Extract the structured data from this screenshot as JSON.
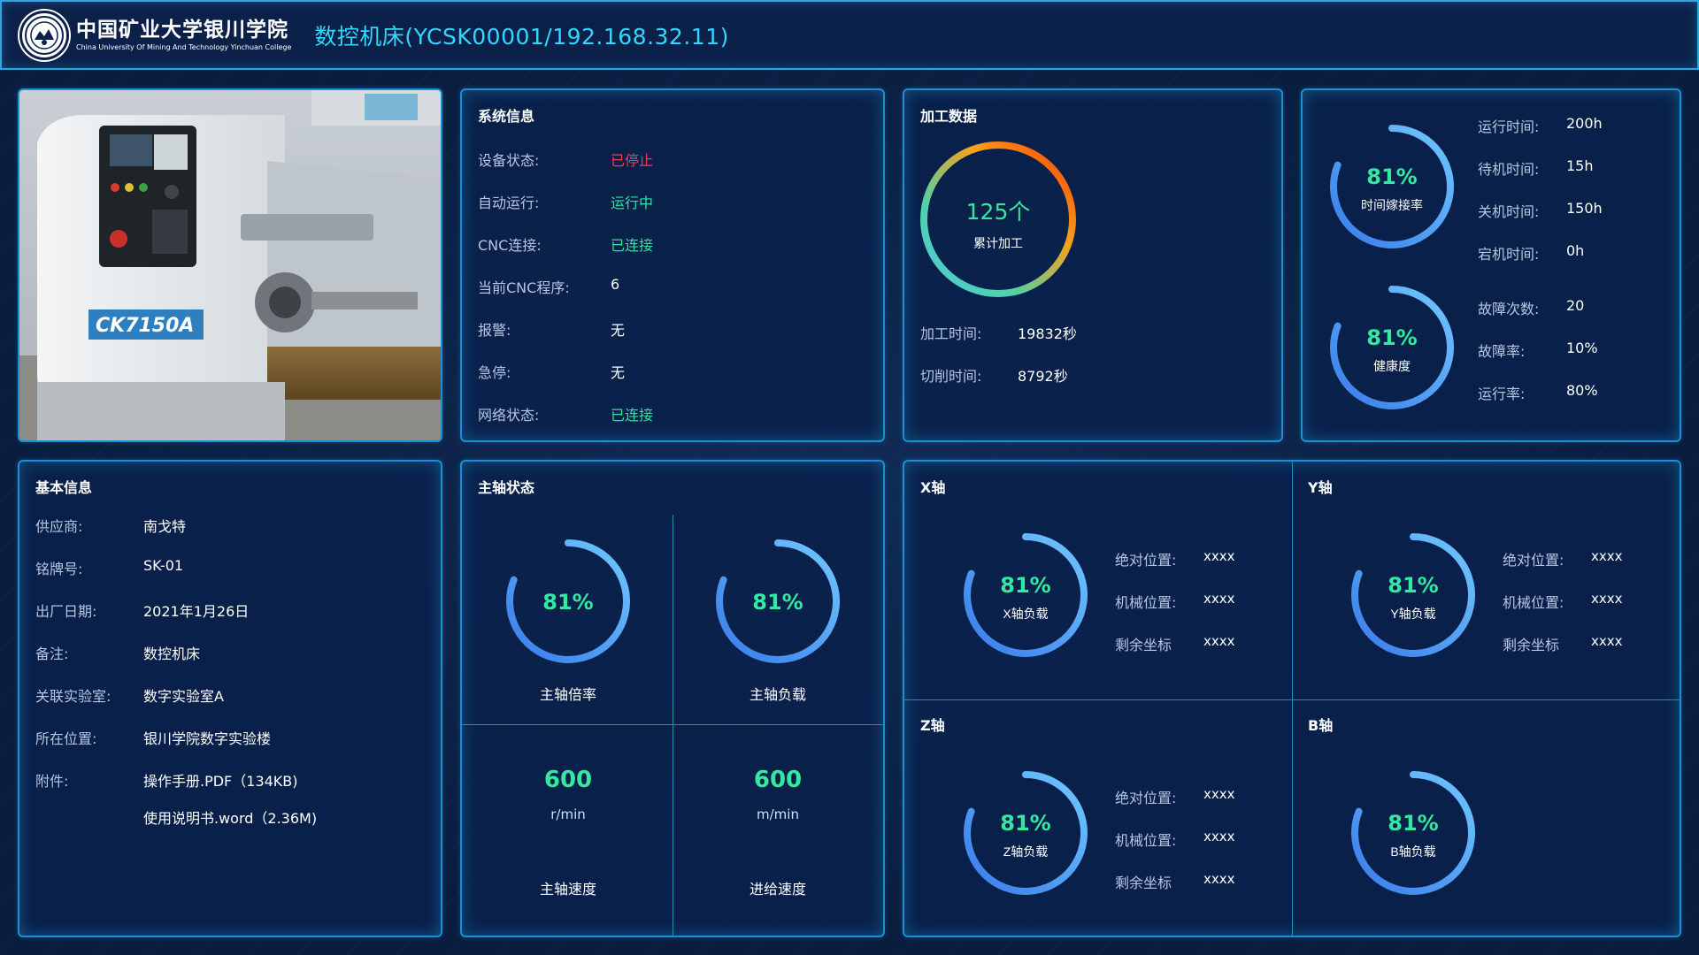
{
  "header": {
    "logo_cn": "中国矿业大学银川学院",
    "logo_en": "China University Of Mining And Technology Yinchuan College",
    "title": "数控机床(YCSK00001/192.168.32.11)"
  },
  "photo": {
    "plate": "CK7150A"
  },
  "system_info": {
    "title": "系统信息",
    "rows": [
      {
        "label": "设备状态:",
        "value": "已停止",
        "color": "#ff3b4a"
      },
      {
        "label": "自动运行:",
        "value": "运行中",
        "color": "#2fe39a"
      },
      {
        "label": "CNC连接:",
        "value": "已连接",
        "color": "#2fe39a"
      },
      {
        "label": "当前CNC程序:",
        "value": "6",
        "color": "#ffffff"
      },
      {
        "label": "报警:",
        "value": "无",
        "color": "#ffffff"
      },
      {
        "label": "急停:",
        "value": "无",
        "color": "#ffffff"
      },
      {
        "label": "网络状态:",
        "value": "已连接",
        "color": "#2fe39a"
      }
    ]
  },
  "processing": {
    "title": "加工数据",
    "total_value": "125个",
    "total_caption": "累计加工",
    "rows": [
      {
        "label": "加工时间:",
        "value": "19832秒"
      },
      {
        "label": "切削时间:",
        "value": "8792秒"
      }
    ]
  },
  "rates": {
    "utilization": {
      "value": "81%",
      "fraction": 0.81,
      "caption": "时间嫁接率"
    },
    "health": {
      "value": "81%",
      "fraction": 0.81,
      "caption": "健康度"
    },
    "time_rows": [
      {
        "label": "运行时间:",
        "value": "200h"
      },
      {
        "label": "待机时间:",
        "value": "15h"
      },
      {
        "label": "关机时间:",
        "value": "150h"
      },
      {
        "label": "宕机时间:",
        "value": "0h"
      }
    ],
    "fault_rows": [
      {
        "label": "故障次数:",
        "value": "20"
      },
      {
        "label": "故障率:",
        "value": "10%"
      },
      {
        "label": "运行率:",
        "value": "80%"
      }
    ]
  },
  "basic_info": {
    "title": "基本信息",
    "rows": [
      {
        "label": "供应商:",
        "value": "南戈特"
      },
      {
        "label": "铭牌号:",
        "value": "SK-01"
      },
      {
        "label": "出厂日期:",
        "value": "2021年1月26日"
      },
      {
        "label": "备注:",
        "value": "数控机床"
      },
      {
        "label": "关联实验室:",
        "value": "数字实验室A"
      },
      {
        "label": "所在位置:",
        "value": "银川学院数字实验楼"
      },
      {
        "label": "附件:",
        "value": "操作手册.PDF（134KB)"
      }
    ],
    "attachment_2": "使用说明书.word（2.36M)"
  },
  "spindle": {
    "title": "主轴状态",
    "rate": {
      "value": "81%",
      "fraction": 0.81,
      "caption": "主轴倍率"
    },
    "load": {
      "value": "81%",
      "fraction": 0.81,
      "caption": "主轴负载"
    },
    "speed": {
      "value": "600",
      "unit": "r/min",
      "caption": "主轴速度"
    },
    "feed": {
      "value": "600",
      "unit": "m/min",
      "caption": "进给速度"
    }
  },
  "axes": [
    {
      "title": "X轴",
      "value": "81%",
      "fraction": 0.81,
      "caption": "X轴负载",
      "rows": [
        {
          "label": "绝对位置:",
          "value": "xxxx"
        },
        {
          "label": "机械位置:",
          "value": "xxxx"
        },
        {
          "label": "剩余坐标",
          "value": "xxxx"
        }
      ]
    },
    {
      "title": "Y轴",
      "value": "81%",
      "fraction": 0.81,
      "caption": "Y轴负载",
      "rows": [
        {
          "label": "绝对位置:",
          "value": "xxxx"
        },
        {
          "label": "机械位置:",
          "value": "xxxx"
        },
        {
          "label": "剩余坐标",
          "value": "xxxx"
        }
      ]
    },
    {
      "title": "Z轴",
      "value": "81%",
      "fraction": 0.81,
      "caption": "Z轴负载",
      "rows": [
        {
          "label": "绝对位置:",
          "value": "xxxx"
        },
        {
          "label": "机械位置:",
          "value": "xxxx"
        },
        {
          "label": "剩余坐标",
          "value": "xxxx"
        }
      ]
    },
    {
      "title": "B轴",
      "value": "81%",
      "fraction": 0.81,
      "caption": "B轴负载",
      "rows": []
    }
  ],
  "colors": {
    "accent": "#33d6ff",
    "gauge_start": "#3a7bea",
    "gauge_end": "#6fc8ff",
    "value_green": "#35e8a1",
    "alarm_red": "#ff3b4a"
  }
}
